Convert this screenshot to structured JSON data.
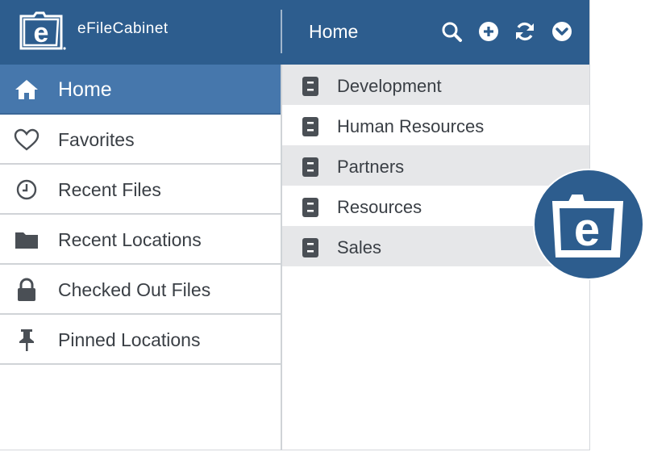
{
  "header": {
    "brand": "eFileCabinet",
    "title": "Home",
    "actions": [
      {
        "icon": "search-icon"
      },
      {
        "icon": "plus-circle-icon"
      },
      {
        "icon": "refresh-icon"
      },
      {
        "icon": "chevron-down-circle-icon"
      }
    ]
  },
  "sidebar": {
    "items": [
      {
        "label": "Home",
        "icon": "home-icon",
        "active": true
      },
      {
        "label": "Favorites",
        "icon": "heart-icon"
      },
      {
        "label": "Recent Files",
        "icon": "clock-icon"
      },
      {
        "label": "Recent Locations",
        "icon": "folder-icon"
      },
      {
        "label": "Checked Out Files",
        "icon": "lock-icon"
      },
      {
        "label": "Pinned Locations",
        "icon": "pin-icon"
      }
    ]
  },
  "main": {
    "cabinets": [
      {
        "label": "Development",
        "icon": "cabinet-icon"
      },
      {
        "label": "Human Resources",
        "icon": "cabinet-icon"
      },
      {
        "label": "Partners",
        "icon": "cabinet-icon"
      },
      {
        "label": "Resources",
        "icon": "cabinet-icon"
      },
      {
        "label": "Sales",
        "icon": "cabinet-icon"
      }
    ]
  },
  "colors": {
    "header_bg": "#2d5d8e",
    "active_bg": "#4677ac",
    "row_shade": "#e6e7e9",
    "icon_gray": "#4a4f55"
  }
}
